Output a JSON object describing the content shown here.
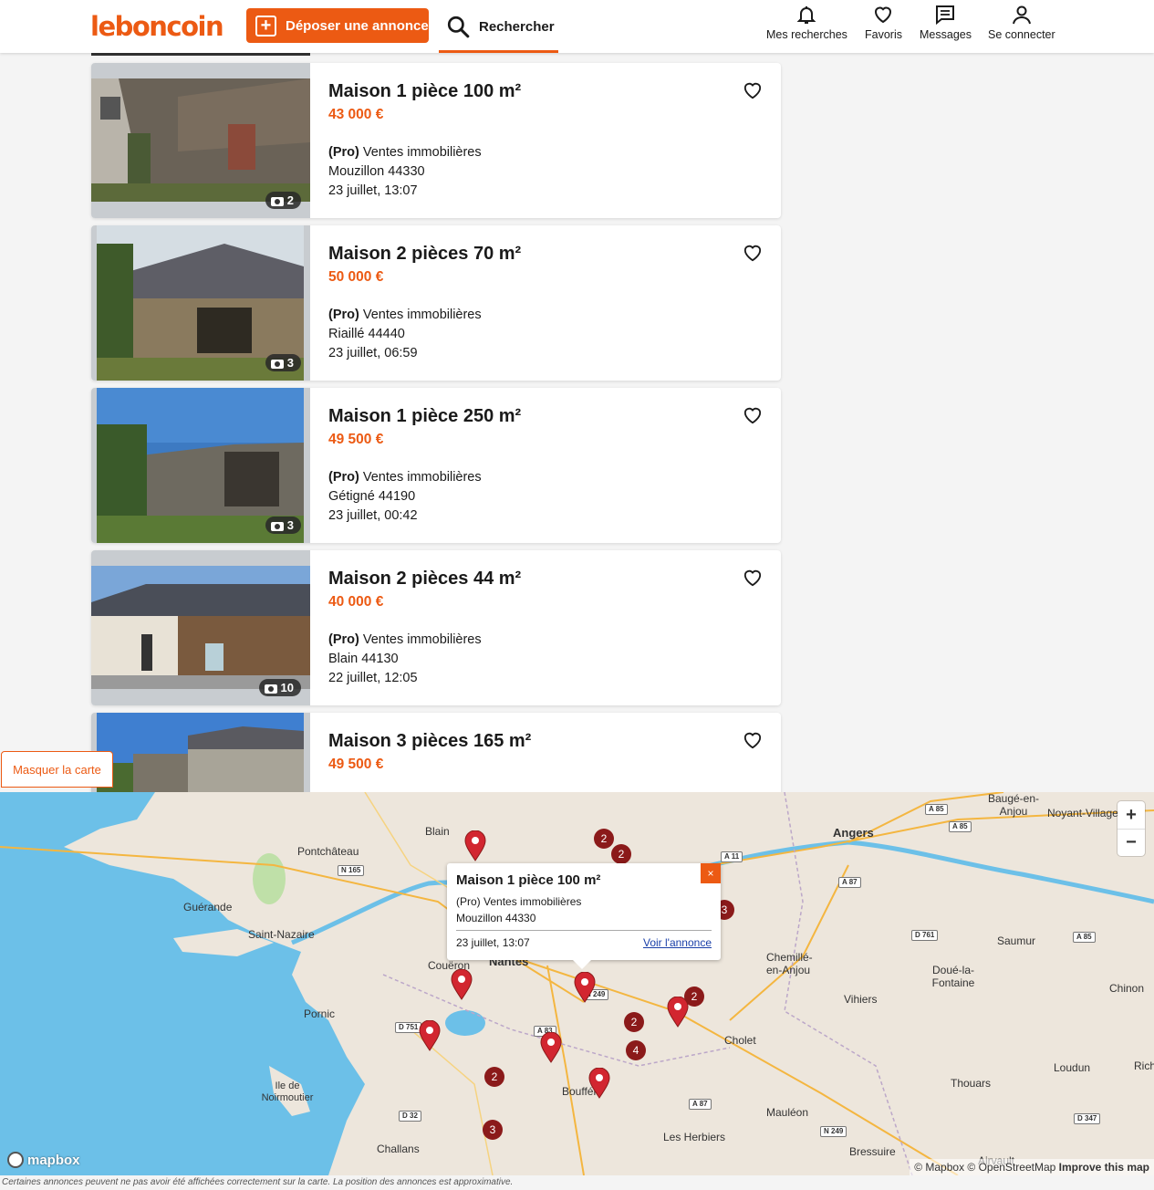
{
  "header": {
    "logo": "leboncoin",
    "deposer_label": "Déposer une annonce",
    "search_label": "Rechercher",
    "nav": [
      {
        "label": "Mes recherches",
        "icon": "bell-icon"
      },
      {
        "label": "Favoris",
        "icon": "heart-icon"
      },
      {
        "label": "Messages",
        "icon": "message-icon"
      },
      {
        "label": "Se connecter",
        "icon": "user-icon"
      }
    ]
  },
  "listings": [
    {
      "title": "Maison 1 pièce 100 m²",
      "price": "43 000 €",
      "seller_tag": "(Pro)",
      "seller": "Ventes immobilières",
      "location": "Mouzillon 44330",
      "date": "23 juillet, 13:07",
      "photos": "2"
    },
    {
      "title": "Maison 2 pièces 70 m²",
      "price": "50 000 €",
      "seller_tag": "(Pro)",
      "seller": "Ventes immobilières",
      "location": "Riaillé 44440",
      "date": "23 juillet, 06:59",
      "photos": "3"
    },
    {
      "title": "Maison 1 pièce 250 m²",
      "price": "49 500 €",
      "seller_tag": "(Pro)",
      "seller": "Ventes immobilières",
      "location": "Gétigné 44190",
      "date": "23 juillet, 00:42",
      "photos": "3"
    },
    {
      "title": "Maison 2 pièces 44 m²",
      "price": "40 000 €",
      "seller_tag": "(Pro)",
      "seller": "Ventes immobilières",
      "location": "Blain 44130",
      "date": "22 juillet, 12:05",
      "photos": "10"
    },
    {
      "title": "Maison 3 pièces 165 m²",
      "price": "49 500 €",
      "seller_tag": "",
      "seller": "",
      "location": "",
      "date": "",
      "photos": ""
    }
  ],
  "map_toggle_label": "Masquer la carte",
  "map": {
    "places": [
      "Blain",
      "Pontchâteau",
      "Guérande",
      "Saint-Nazaire",
      "Couëron",
      "Nantes",
      "Pornic",
      "Ile de Noirmoutier",
      "Challans",
      "Bouffére",
      "Les Herbiers",
      "Cholet",
      "Mauléon",
      "Angers",
      "Baugé-en-Anjou",
      "Noyant-Villages",
      "Saumur",
      "Chemillé-en-Anjou",
      "Doué-la-Fontaine",
      "Vihiers",
      "Chinon",
      "Loudun",
      "Thouars",
      "Bressuire",
      "Airvault",
      "Rich"
    ],
    "roads": [
      "N 165",
      "A 11",
      "A 85",
      "A 87",
      "D 761",
      "N 249",
      "A 83",
      "D 751",
      "D 32",
      "D 347"
    ],
    "clusters": [
      "2",
      "2",
      "3",
      "2",
      "2",
      "4",
      "2",
      "3"
    ],
    "zoom_in": "+",
    "zoom_out": "−",
    "popup": {
      "title": "Maison 1 pièce 100 m²",
      "seller": "(Pro) Ventes immobilières",
      "location": "Mouzillon 44330",
      "date": "23 juillet, 13:07",
      "link": "Voir l'annonce",
      "close": "×"
    },
    "mapbox_logo": "mapbox",
    "attribution": "© Mapbox © OpenStreetMap",
    "improve": "Improve this map"
  },
  "disclaimer": "Certaines annonces peuvent ne pas avoir été affichées correctement sur la carte. La position des annonces est approximative.",
  "colors": {
    "brand": "#ec5a13",
    "cluster": "#8b1a1a",
    "pin": "#d22630",
    "sea": "#6cc0e8",
    "land": "#ede6dc"
  }
}
